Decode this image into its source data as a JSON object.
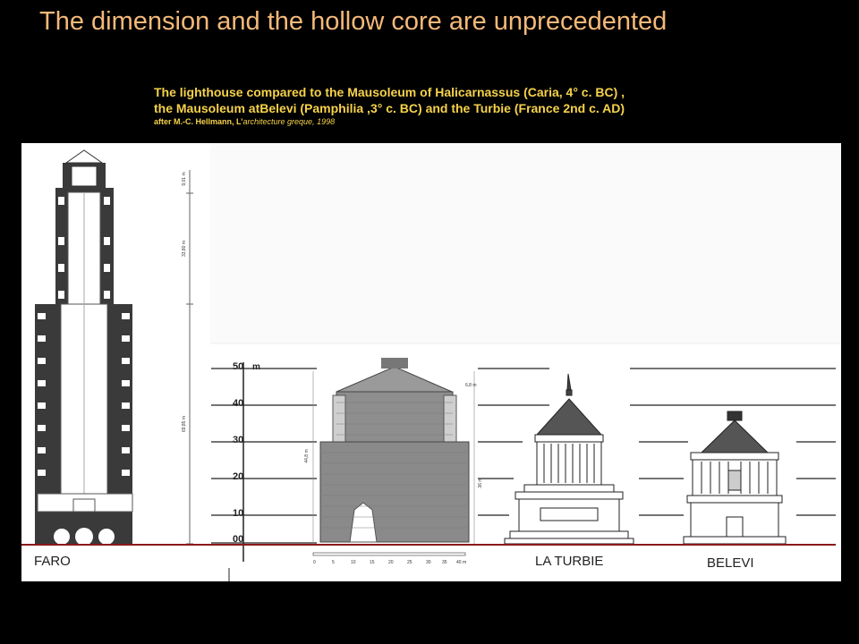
{
  "slide": {
    "title": "The dimension and the hollow core are unprecedented"
  },
  "caption": {
    "line1": "The lighthouse compared to the Mausoleum of Halicarnassus (Caria, 4° c. BC) ,",
    "line2": "the Mausoleum atBelevi (Pamphilia ,3° c. BC) and the Turbie (France 2nd c. AD)",
    "credit_prefix": "after M.-C. Hellmann, L’",
    "credit_title": "architecture greque, 1998"
  },
  "figure": {
    "labels": {
      "faro": "FARO",
      "la_turbie": "LA TURBIE",
      "belevi": "BELEVI"
    },
    "scale": {
      "unit": "m",
      "ticks": [
        "50",
        "40",
        "30",
        "20",
        "10",
        "00"
      ]
    },
    "faro_dims": [
      "9,01 m",
      "33,80 m",
      "69,85 m"
    ],
    "mausoleum_dims": [
      "6,8 m",
      "44,8 m",
      "36 m"
    ],
    "bar_scale": [
      "0",
      "5",
      "10",
      "15",
      "20",
      "25",
      "30",
      "35",
      "40 m"
    ],
    "colors": {
      "background": "#000000",
      "title": "#f5b979",
      "caption": "#f6d24a",
      "ground_line": "#8b1a1a",
      "faro_fill": "#3a3a3a"
    }
  }
}
